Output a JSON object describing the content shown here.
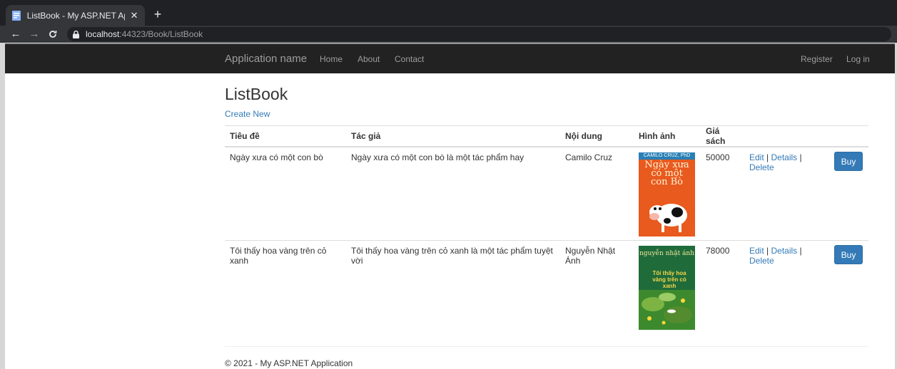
{
  "browser": {
    "tab_title": "ListBook - My ASP.NET Applicatio",
    "tab_close": "✕",
    "new_tab": "+",
    "url_host": "localhost",
    "url_rest": ":44323/Book/ListBook"
  },
  "navbar": {
    "brand": "Application name",
    "links": [
      "Home",
      "About",
      "Contact"
    ],
    "right_links": [
      "Register",
      "Log in"
    ]
  },
  "page": {
    "title": "ListBook",
    "create_new": "Create New"
  },
  "table": {
    "headers": [
      "Tiêu đề",
      "Tác giả",
      "Nội dung",
      "Hình ảnh",
      "Giá sách"
    ],
    "rows": [
      {
        "title": "Ngày xưa có một con bò",
        "author": "Ngày xưa có một con bò là một tác phẩm hay",
        "content": "Camilo Cruz",
        "price": "50000",
        "cover": {
          "top_text": "CAMILO CRUZ, PhD",
          "title": "Ngày xưa có một con Bò"
        }
      },
      {
        "title": "Tôi thấy hoa vàng trên cỏ xanh",
        "author": "Tôi thấy hoa vàng trên cỏ xanh là một tác phẩm tuyệt vời",
        "content": "Nguyễn Nhật Ánh",
        "price": "78000",
        "cover": {
          "top_text": "nguyễn nhật ánh",
          "title": "Tôi thấy hoa vàng trên cỏ xanh"
        }
      }
    ],
    "actions": {
      "edit": "Edit",
      "details": "Details",
      "delete": "Delete",
      "separator": "|",
      "buy": "Buy"
    }
  },
  "footer": {
    "text": "© 2021 - My ASP.NET Application"
  },
  "colors": {
    "link": "#337ab7",
    "navbar_bg": "#222222",
    "buy_bg": "#337ab7"
  }
}
